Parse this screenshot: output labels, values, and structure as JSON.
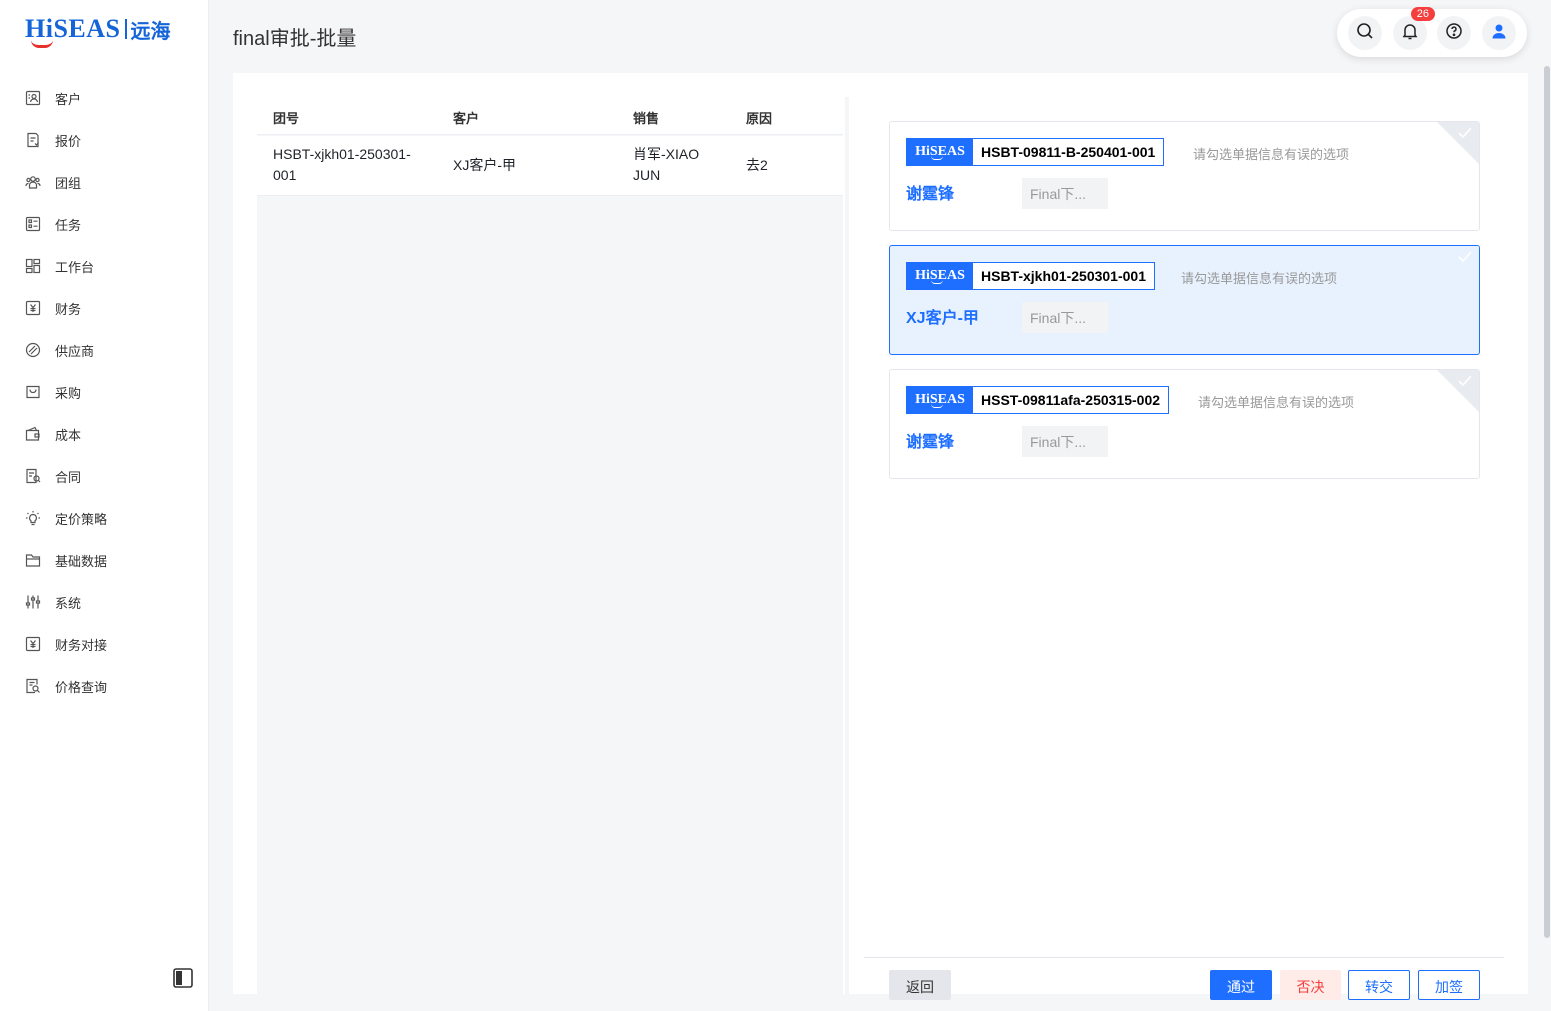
{
  "brand": {
    "logo_text": "HiSEAS",
    "logo_cn": "远海",
    "accent": "#1e6fff",
    "logo_color": "#1565d8"
  },
  "sidebar": {
    "items": [
      {
        "label": "客户",
        "icon": "customer-icon"
      },
      {
        "label": "报价",
        "icon": "quote-icon"
      },
      {
        "label": "团组",
        "icon": "group-icon"
      },
      {
        "label": "任务",
        "icon": "task-icon"
      },
      {
        "label": "工作台",
        "icon": "workbench-icon"
      },
      {
        "label": "财务",
        "icon": "finance-icon"
      },
      {
        "label": "供应商",
        "icon": "supplier-icon"
      },
      {
        "label": "采购",
        "icon": "purchase-icon"
      },
      {
        "label": "成本",
        "icon": "cost-icon"
      },
      {
        "label": "合同",
        "icon": "contract-icon"
      },
      {
        "label": "定价策略",
        "icon": "bulb-icon"
      },
      {
        "label": "基础数据",
        "icon": "folder-icon"
      },
      {
        "label": "系统",
        "icon": "sliders-icon"
      },
      {
        "label": "财务对接",
        "icon": "finance-link-icon"
      },
      {
        "label": "价格查询",
        "icon": "price-search-icon"
      }
    ]
  },
  "header": {
    "title": "final审批-批量",
    "notification_count": "26"
  },
  "table": {
    "columns": [
      "团号",
      "客户",
      "销售",
      "原因"
    ],
    "rows": [
      {
        "group_no_line1": "HSBT-xjkh01-250301-",
        "group_no_line2": "001",
        "customer": "XJ客户-甲",
        "sales_line1": "肖军-XIAO",
        "sales_line2": "JUN",
        "reason": "去2"
      }
    ]
  },
  "cards": [
    {
      "logo": "HiSEAS",
      "code": "HSBT-09811-B-250401-001",
      "hint": "请勾选单据信息有误的选项",
      "name": "谢霆锋",
      "chip": "Final下...",
      "selected": false
    },
    {
      "logo": "HiSEAS",
      "code": "HSBT-xjkh01-250301-001",
      "hint": "请勾选单据信息有误的选项",
      "name": "XJ客户-甲",
      "chip": "Final下...",
      "selected": true
    },
    {
      "logo": "HiSEAS",
      "code": "HSST-09811afa-250315-002",
      "hint": "请勾选单据信息有误的选项",
      "name": "谢霆锋",
      "chip": "Final下...",
      "selected": false
    }
  ],
  "footer": {
    "back": "返回",
    "pass": "通过",
    "reject": "否决",
    "transfer": "转交",
    "add_sign": "加签"
  }
}
